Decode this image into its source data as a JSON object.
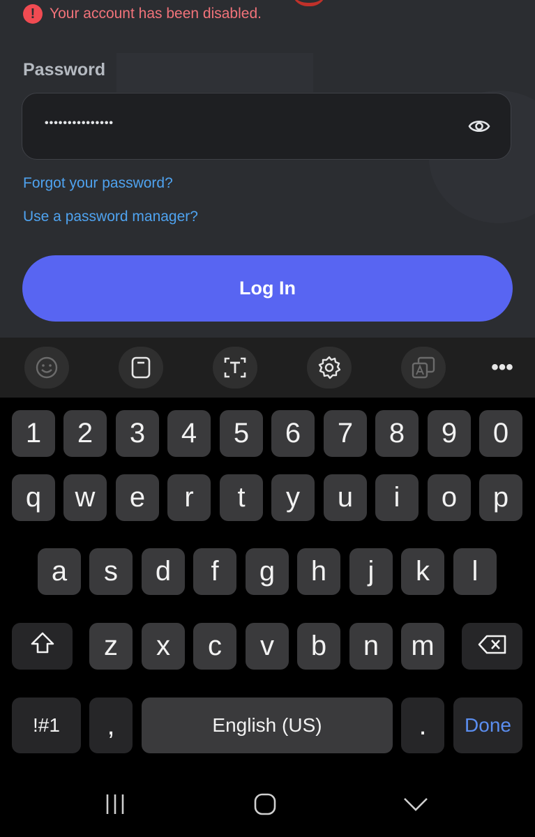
{
  "error": {
    "message": "Your account has been disabled.",
    "icon": "alert-circle-icon"
  },
  "password": {
    "label": "Password",
    "value": "•••••••••••••••",
    "toggle_icon": "eye-icon"
  },
  "links": {
    "forgot": "Forgot your password?",
    "manager": "Use a password manager?"
  },
  "login_button": "Log In",
  "toolbar": {
    "items": [
      "emoji-icon",
      "clipboard-icon",
      "text-select-icon",
      "settings-icon",
      "translate-icon",
      "more-icon"
    ],
    "more_label": "•••"
  },
  "keyboard": {
    "numbers": [
      "1",
      "2",
      "3",
      "4",
      "5",
      "6",
      "7",
      "8",
      "9",
      "0"
    ],
    "row1": [
      "q",
      "w",
      "e",
      "r",
      "t",
      "y",
      "u",
      "i",
      "o",
      "p"
    ],
    "row2": [
      "a",
      "s",
      "d",
      "f",
      "g",
      "h",
      "j",
      "k",
      "l"
    ],
    "row3": [
      "z",
      "x",
      "c",
      "v",
      "b",
      "n",
      "m"
    ],
    "symbols": "!#1",
    "comma": ",",
    "space": "English (US)",
    "period": ".",
    "done": "Done"
  },
  "colors": {
    "accent": "#5865f2",
    "error": "#f04b52",
    "link": "#4fa3f0",
    "done": "#5b8ef0"
  }
}
